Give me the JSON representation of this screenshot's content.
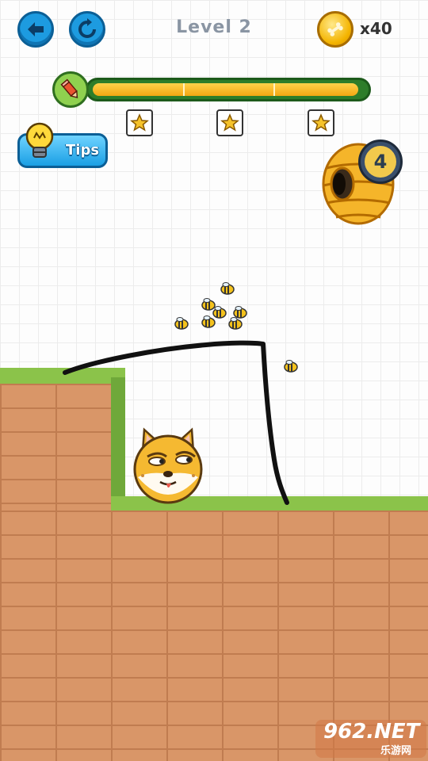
{
  "header": {
    "level_title": "Level 2",
    "coin_count": "x40",
    "back_icon": "arrow-left-icon",
    "restart_icon": "refresh-icon",
    "coin_icon": "bone-icon"
  },
  "ink": {
    "fill_fraction": 0.98,
    "stars_thresholds": 3
  },
  "tips": {
    "label": "Tips",
    "icon": "lightbulb-icon"
  },
  "hive": {
    "timer_value": "4",
    "timer_icon": "stopwatch-icon"
  },
  "watermark": {
    "main": "962.NET",
    "sub": "乐游网"
  },
  "colors": {
    "button_blue": "#1d9be0",
    "grass": "#8bc34a",
    "brick": "#d99668",
    "ink_fill": "#f3a712",
    "ink_bar": "#2e7d2a"
  }
}
